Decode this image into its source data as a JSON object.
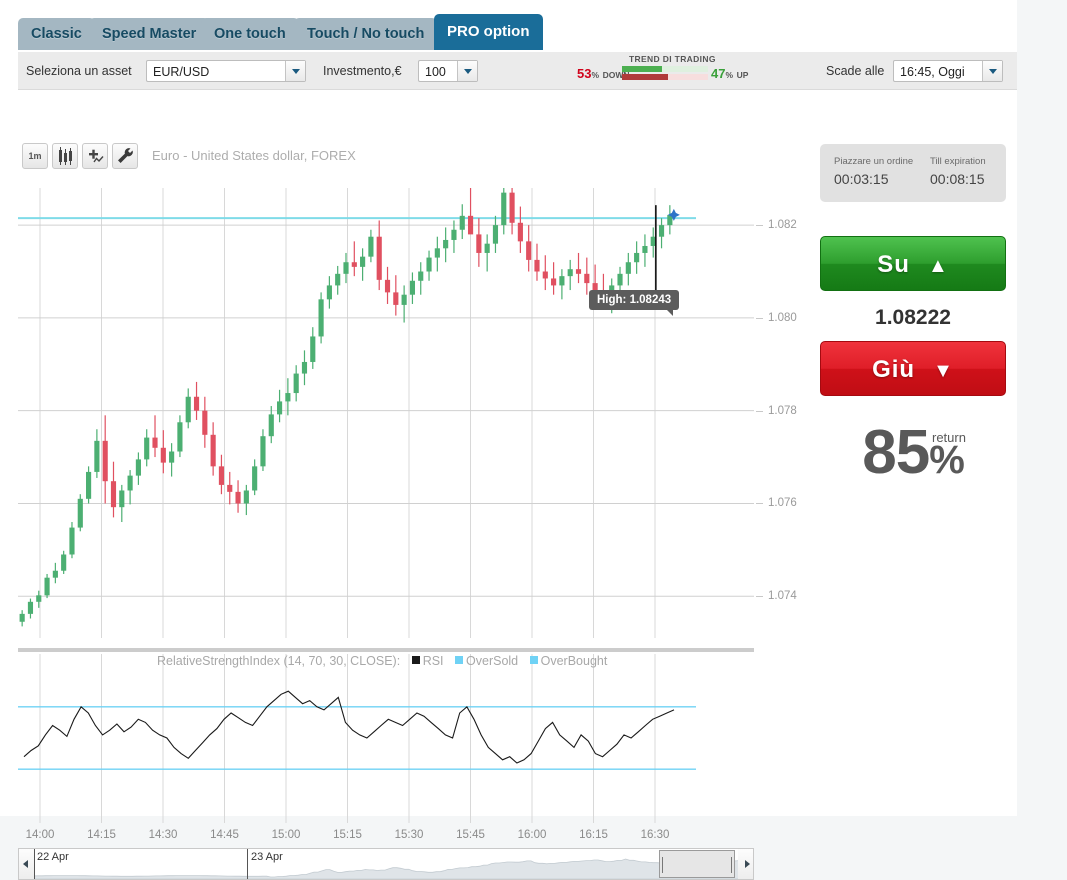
{
  "tabs": [
    {
      "label": "Classic",
      "active": false
    },
    {
      "label": "Speed Master",
      "active": false
    },
    {
      "label": "One touch",
      "active": false
    },
    {
      "label": "Touch / No touch",
      "active": false
    },
    {
      "label": "PRO option",
      "active": true
    }
  ],
  "options_bar": {
    "asset_label": "Seleziona un asset",
    "asset_value": "EUR/USD",
    "investment_label": "Investmento,€",
    "investment_value": "100",
    "expiry_label": "Scade alle",
    "expiry_value": "16:45, Oggi"
  },
  "trend": {
    "title": "TREND DI TRADING",
    "down_value": "53",
    "down_unit": "%",
    "down_word": "DOWN",
    "up_value": "47",
    "up_unit": "%",
    "up_word": "UP",
    "down_pct": 53,
    "up_pct": 47,
    "up_color": "#4caf50",
    "down_color": "#b03a3a"
  },
  "chart": {
    "toolbar": [
      {
        "name": "timeframe-button",
        "label": "1m",
        "icon": "text"
      },
      {
        "name": "chart-type-button",
        "label": "",
        "icon": "candles-icon"
      },
      {
        "name": "add-indicator-button",
        "label": "",
        "icon": "plus-line-icon"
      },
      {
        "name": "settings-button",
        "label": "",
        "icon": "wrench-icon"
      }
    ],
    "title": "Euro - United States dollar, FOREX",
    "tooltip": "High: 1.08243",
    "y_labels": [
      "1.082",
      "1.080",
      "1.078",
      "1.076",
      "1.074"
    ],
    "x_labels": [
      "14:00",
      "14:15",
      "14:30",
      "14:45",
      "15:00",
      "15:15",
      "15:30",
      "15:45",
      "16:00",
      "16:15",
      "16:30"
    ],
    "rsi_legend_text": "RelativeStrengthIndex (14, 70, 30, CLOSE):",
    "rsi_series": [
      "RSI",
      "OverSold",
      "OverBought"
    ],
    "navigator": {
      "date_left": "22 Apr",
      "date_right": "23 Apr"
    }
  },
  "chart_data": {
    "type": "line",
    "title": "Euro - United States dollar, FOREX",
    "xlabel": "",
    "ylabel": "",
    "ylim": [
      1.0731,
      1.0828
    ],
    "y_ticks": [
      1.074,
      1.076,
      1.078,
      1.08,
      1.082
    ],
    "x_ticks": [
      "14:00",
      "14:15",
      "14:30",
      "14:45",
      "15:00",
      "15:15",
      "15:30",
      "15:45",
      "16:00",
      "16:15",
      "16:30"
    ],
    "grid": true,
    "legend": "none",
    "current_price": 1.08222,
    "session_high": 1.08243,
    "resistance_line": 1.08215,
    "series": [
      {
        "name": "EUR/USD candles",
        "type": "candlestick",
        "up_color": "#4caf72",
        "down_color": "#e05060",
        "ohlc": [
          [
            1.07345,
            1.0737,
            1.07335,
            1.07362
          ],
          [
            1.07362,
            1.07395,
            1.07352,
            1.07388
          ],
          [
            1.07388,
            1.07412,
            1.07375,
            1.07402
          ],
          [
            1.07402,
            1.07448,
            1.07396,
            1.0744
          ],
          [
            1.0744,
            1.07472,
            1.07428,
            1.07455
          ],
          [
            1.07455,
            1.07498,
            1.07448,
            1.0749
          ],
          [
            1.0749,
            1.0756,
            1.07482,
            1.07548
          ],
          [
            1.07548,
            1.0762,
            1.0754,
            1.0761
          ],
          [
            1.0761,
            1.0768,
            1.076,
            1.07668
          ],
          [
            1.07668,
            1.0776,
            1.07655,
            1.07735
          ],
          [
            1.07735,
            1.0779,
            1.076,
            1.07648
          ],
          [
            1.07648,
            1.0769,
            1.0757,
            1.07592
          ],
          [
            1.07592,
            1.0764,
            1.0756,
            1.07628
          ],
          [
            1.07628,
            1.07672,
            1.07598,
            1.0766
          ],
          [
            1.0766,
            1.0771,
            1.0764,
            1.07695
          ],
          [
            1.07695,
            1.0776,
            1.0768,
            1.07742
          ],
          [
            1.07742,
            1.0779,
            1.077,
            1.0772
          ],
          [
            1.0772,
            1.07758,
            1.07665,
            1.07688
          ],
          [
            1.07688,
            1.0773,
            1.07658,
            1.07712
          ],
          [
            1.07712,
            1.0779,
            1.077,
            1.07775
          ],
          [
            1.07775,
            1.07848,
            1.07762,
            1.0783
          ],
          [
            1.0783,
            1.07862,
            1.0778,
            1.078
          ],
          [
            1.078,
            1.0783,
            1.0772,
            1.07748
          ],
          [
            1.07748,
            1.07775,
            1.0766,
            1.0768
          ],
          [
            1.0768,
            1.07705,
            1.0762,
            1.0764
          ],
          [
            1.0764,
            1.07668,
            1.07598,
            1.07625
          ],
          [
            1.07625,
            1.0765,
            1.0758,
            1.076
          ],
          [
            1.076,
            1.0764,
            1.07575,
            1.07628
          ],
          [
            1.07628,
            1.07695,
            1.07618,
            1.0768
          ],
          [
            1.0768,
            1.0776,
            1.0767,
            1.07745
          ],
          [
            1.07745,
            1.0781,
            1.0773,
            1.07792
          ],
          [
            1.07792,
            1.07845,
            1.07775,
            1.0782
          ],
          [
            1.0782,
            1.0787,
            1.0779,
            1.07838
          ],
          [
            1.07838,
            1.07898,
            1.0782,
            1.0788
          ],
          [
            1.0788,
            1.0793,
            1.07855,
            1.07905
          ],
          [
            1.07905,
            1.0798,
            1.0789,
            1.0796
          ],
          [
            1.0796,
            1.08055,
            1.07945,
            1.0804
          ],
          [
            1.0804,
            1.0809,
            1.0802,
            1.0807
          ],
          [
            1.0807,
            1.08112,
            1.0805,
            1.08095
          ],
          [
            1.08095,
            1.0814,
            1.08075,
            1.0812
          ],
          [
            1.0812,
            1.08165,
            1.0809,
            1.0811
          ],
          [
            1.0811,
            1.0815,
            1.0808,
            1.08132
          ],
          [
            1.08132,
            1.0819,
            1.0812,
            1.08175
          ],
          [
            1.08175,
            1.0821,
            1.0806,
            1.08082
          ],
          [
            1.08082,
            1.0811,
            1.0803,
            1.08055
          ],
          [
            1.08055,
            1.08092,
            1.08005,
            1.08028
          ],
          [
            1.08028,
            1.0807,
            1.0799,
            1.0805
          ],
          [
            1.0805,
            1.08098,
            1.0803,
            1.0808
          ],
          [
            1.0808,
            1.0812,
            1.0805,
            1.081
          ],
          [
            1.081,
            1.08145,
            1.0808,
            1.0813
          ],
          [
            1.0813,
            1.08175,
            1.081,
            1.0815
          ],
          [
            1.0815,
            1.08195,
            1.0812,
            1.08168
          ],
          [
            1.08168,
            1.0821,
            1.0814,
            1.0819
          ],
          [
            1.0819,
            1.08245,
            1.0817,
            1.0822
          ],
          [
            1.0822,
            1.0828,
            1.082,
            1.0818
          ],
          [
            1.0818,
            1.08215,
            1.0811,
            1.0814
          ],
          [
            1.0814,
            1.0818,
            1.081,
            1.0816
          ],
          [
            1.0816,
            1.0822,
            1.0814,
            1.082
          ],
          [
            1.082,
            1.0829,
            1.0818,
            1.0827
          ],
          [
            1.0827,
            1.083,
            1.0818,
            1.08205
          ],
          [
            1.08205,
            1.0824,
            1.0814,
            1.08165
          ],
          [
            1.08165,
            1.082,
            1.081,
            1.08125
          ],
          [
            1.08125,
            1.0816,
            1.0808,
            1.081
          ],
          [
            1.081,
            1.08135,
            1.0806,
            1.08085
          ],
          [
            1.08085,
            1.0812,
            1.0805,
            1.0807
          ],
          [
            1.0807,
            1.08105,
            1.0804,
            1.0809
          ],
          [
            1.0809,
            1.08125,
            1.0806,
            1.08105
          ],
          [
            1.08105,
            1.0814,
            1.08075,
            1.08095
          ],
          [
            1.08095,
            1.0813,
            1.0805,
            1.08075
          ],
          [
            1.08075,
            1.08115,
            1.0804,
            1.0806
          ],
          [
            1.0806,
            1.08095,
            1.0802,
            1.08045
          ],
          [
            1.08045,
            1.08085,
            1.0801,
            1.0807
          ],
          [
            1.0807,
            1.0811,
            1.08045,
            1.08095
          ],
          [
            1.08095,
            1.0814,
            1.0807,
            1.0812
          ],
          [
            1.0812,
            1.08165,
            1.08095,
            1.0814
          ],
          [
            1.0814,
            1.0818,
            1.0811,
            1.08155
          ],
          [
            1.08155,
            1.08195,
            1.0813,
            1.08175
          ],
          [
            1.08175,
            1.08215,
            1.0815,
            1.082
          ],
          [
            1.082,
            1.08243,
            1.0818,
            1.08222
          ]
        ]
      },
      {
        "name": "RSI",
        "type": "line",
        "color": "#1a1a1a",
        "period": 14,
        "overbought": 70,
        "oversold": 30,
        "values": [
          38,
          42,
          45,
          52,
          58,
          55,
          51,
          62,
          70,
          66,
          58,
          52,
          55,
          59,
          54,
          57,
          62,
          60,
          55,
          52,
          50,
          44,
          40,
          37,
          42,
          47,
          52,
          56,
          62,
          66,
          63,
          60,
          58,
          64,
          70,
          74,
          78,
          80,
          76,
          72,
          74,
          70,
          68,
          72,
          76,
          60,
          55,
          52,
          50,
          54,
          58,
          62,
          60,
          58,
          62,
          66,
          64,
          60,
          56,
          52,
          50,
          66,
          70,
          62,
          52,
          44,
          40,
          36,
          38,
          34,
          36,
          40,
          48,
          56,
          60,
          52,
          48,
          44,
          52,
          48,
          40,
          38,
          42,
          46,
          52,
          50,
          54,
          58,
          62,
          64,
          66,
          68
        ]
      }
    ]
  },
  "right_panel": {
    "place_order_label": "Piazzare un ordine",
    "place_order_value": "00:03:15",
    "till_expiration_label": "Till expiration",
    "till_expiration_value": "00:08:15",
    "up_button_label": "Su",
    "up_button_arrow": "▲",
    "down_button_label": "Giù",
    "down_button_arrow": "▼",
    "current_price": "1.08222",
    "return_number": "85",
    "return_pct": "%",
    "return_word": "return"
  }
}
